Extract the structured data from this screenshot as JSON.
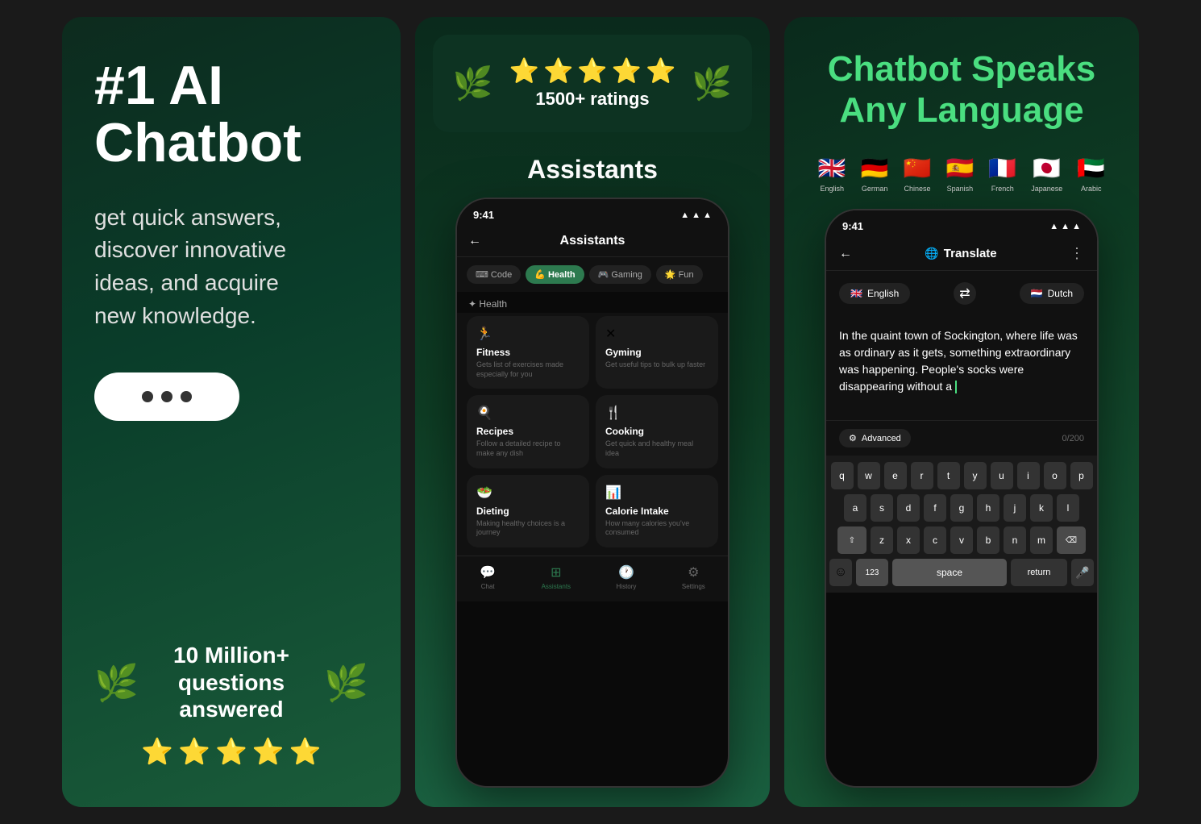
{
  "panel1": {
    "title": "#1 AI\nChatbot",
    "subtitle": "get quick answers,\ndiscover innovative\nideas, and acquire\nnew knowledge.",
    "laurel_left": "🌿",
    "laurel_right": "🌿",
    "million_line1": "10 Million+",
    "million_line2": "questions answered",
    "stars": [
      "⭐",
      "⭐",
      "⭐",
      "⭐",
      "⭐"
    ]
  },
  "panel2": {
    "ratings_text": "1500+ ratings",
    "stars": [
      "⭐",
      "⭐",
      "⭐",
      "⭐",
      "⭐"
    ],
    "assistants_label": "Assistants",
    "phone": {
      "time": "9:41",
      "header_title": "Assistants",
      "tabs": [
        "Code",
        "Health",
        "Gaming",
        "Fun"
      ],
      "active_tab": "Health",
      "section_label": "Health",
      "cards": [
        {
          "icon": "🏃",
          "title": "Fitness",
          "desc": "Gets list of exercises made especially for you"
        },
        {
          "icon": "✕",
          "title": "Gyming",
          "desc": "Get useful tips to bulk up faster"
        },
        {
          "icon": "🍳",
          "title": "Recipes",
          "desc": "Follow a detailed recipe to make any dish"
        },
        {
          "icon": "🍴",
          "title": "Cooking",
          "desc": "Get quick and healthy meal idea"
        },
        {
          "icon": "🥗",
          "title": "Dieting",
          "desc": "Making healthy choices is a journey"
        },
        {
          "icon": "📊",
          "title": "Calorie Intake",
          "desc": "How many calories you've consumed"
        }
      ],
      "nav_items": [
        "Chat",
        "Assistants",
        "History",
        "Settings"
      ]
    }
  },
  "panel3": {
    "title": "Chatbot Speaks\nAny Language",
    "languages": [
      {
        "flag": "🇬🇧",
        "name": "English"
      },
      {
        "flag": "🇩🇪",
        "name": "German"
      },
      {
        "flag": "🇨🇳",
        "name": "Chinese"
      },
      {
        "flag": "🇪🇸",
        "name": "Spanish"
      },
      {
        "flag": "🇫🇷",
        "name": "French"
      },
      {
        "flag": "🇯🇵",
        "name": "Japanese"
      },
      {
        "flag": "🇦🇪",
        "name": "Arabic"
      }
    ],
    "phone": {
      "time": "9:41",
      "header_title": "Translate",
      "from_lang": "English",
      "to_lang": "Dutch",
      "from_flag": "🇬🇧",
      "to_flag": "🇳🇱",
      "input_text": "In the quaint town of Sockington, where life was as ordinary as it gets, something extraordinary was happening. People's socks were disappearing without a ",
      "advanced_label": "Advanced",
      "char_count": "0/200",
      "keyboard_rows": [
        [
          "q",
          "w",
          "e",
          "r",
          "t",
          "y",
          "u",
          "i",
          "o",
          "p"
        ],
        [
          "a",
          "s",
          "d",
          "f",
          "g",
          "h",
          "j",
          "k",
          "l"
        ],
        [
          "z",
          "x",
          "c",
          "v",
          "b",
          "n",
          "m"
        ]
      ],
      "space_label": "space",
      "return_label": "return",
      "num_label": "123"
    }
  }
}
